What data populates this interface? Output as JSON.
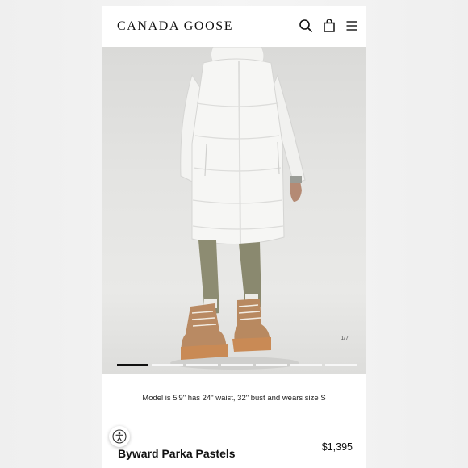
{
  "header": {
    "brand": "CANADA GOOSE",
    "icons": [
      "search-icon",
      "shopping-bag-icon",
      "menu-icon"
    ]
  },
  "gallery": {
    "counter": "1/7",
    "total_slides": 7,
    "active_slide": 1,
    "image_subject": "white long down parka with tan boots"
  },
  "product": {
    "model_info": "Model is 5'9\" has 24\" waist, 32\" bust and wears size S",
    "name": "Byward Parka Pastels",
    "price": "$1,395"
  },
  "accessibility": {
    "icon": "accessibility-icon"
  }
}
